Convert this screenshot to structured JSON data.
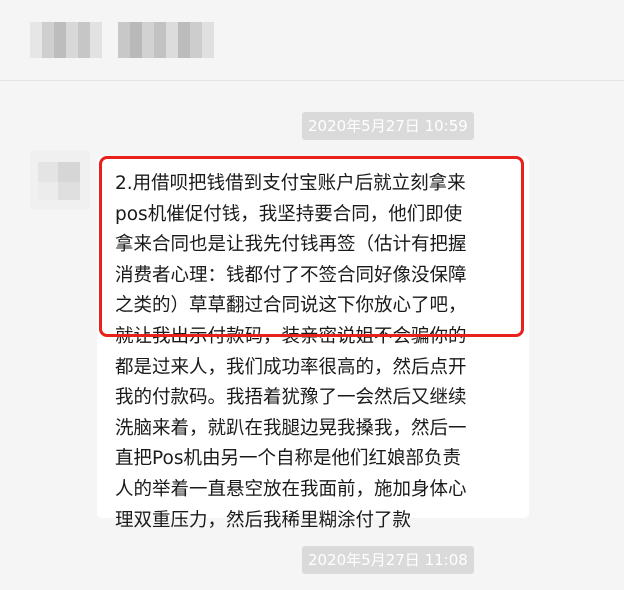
{
  "timestamps": [
    "2020年5月27日 10:59",
    "2020年5月27日 11:08"
  ],
  "message": {
    "lines": [
      "2.用借呗把钱借到支付宝账户后就立刻拿来",
      "pos机催促付钱，我坚持要合同，他们即使",
      "拿来合同也是让我先付钱再签（估计有把握",
      "消费者心理：钱都付了不签合同好像没保障",
      "之类的）草草翻过合同说这下你放心了吧，",
      "就让我出示付款码，装亲密说姐不会骗你的",
      "都是过来人，我们成功率很高的，然后点开",
      "我的付款码。我捂着犹豫了一会然后又继续",
      "洗脑来着，就趴在我腿边晃我搡我，然后一",
      "直把Pos机由另一个自称是他们红娘部负责",
      "人的举着一直悬空放在我面前，施加身体心",
      "理双重压力，然后我稀里糊涂付了款"
    ]
  },
  "colors": {
    "background": "#f5f5f5",
    "bubble": "#ffffff",
    "highlight_border": "#e8211d",
    "timestamp_pill": "#dadada"
  }
}
